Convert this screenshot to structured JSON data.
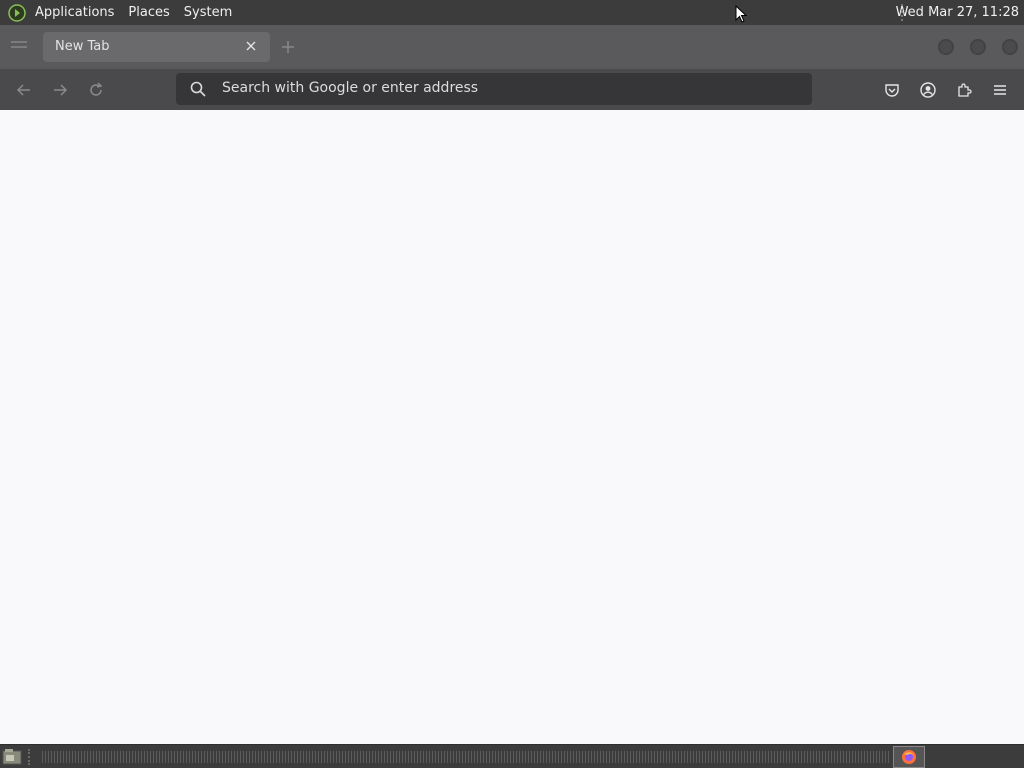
{
  "top_panel": {
    "menus": [
      "Applications",
      "Places",
      "System"
    ],
    "clock": "Wed Mar 27, 11:28"
  },
  "browser": {
    "tab": {
      "title": "New Tab"
    },
    "url_bar": {
      "placeholder": "Search with Google or enter address"
    }
  },
  "icons": {
    "menu_logo": "mint-logo-icon",
    "close_tab": "close-icon",
    "back": "arrow-left-icon",
    "forward": "arrow-right-icon",
    "reload": "reload-icon",
    "search": "search-icon",
    "pocket": "pocket-icon",
    "account": "account-icon",
    "extensions": "puzzle-icon",
    "menu": "hamburger-icon",
    "show_desktop": "show-desktop-icon",
    "firefox": "firefox-icon"
  },
  "colors": {
    "panel": "#3c3c3c",
    "tab_strip": "#5a5a5c",
    "nav_bar": "#4a4a4c",
    "url_bar": "#363638",
    "page_background": "#f9f9fb"
  }
}
